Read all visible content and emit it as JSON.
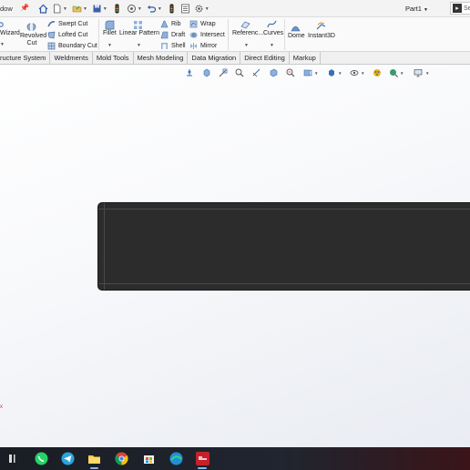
{
  "titlebar": {
    "app_menu_label": "dow",
    "document_title": "Part1",
    "search_placeholder": "Se"
  },
  "ribbon": {
    "wizard_label": "Wizard",
    "revolved_cut_line1": "Revolved",
    "revolved_cut_line2": "Cut",
    "swept_cut_label": "Swept Cut",
    "lofted_cut_label": "Lofted Cut",
    "boundary_cut_label": "Boundary Cut",
    "fillet_label": "Fillet",
    "linear_pattern_label": "Linear Pattern",
    "rib_label": "Rib",
    "draft_label": "Draft",
    "shell_label": "Shell",
    "wrap_label": "Wrap",
    "intersect_label": "Intersect",
    "mirror_label": "Mirror",
    "reference_label": "Referenc...",
    "curves_label": "Curves",
    "dome_label": "Dome",
    "instant3d_label": "Instant3D"
  },
  "tabs": [
    {
      "label": "ructure System"
    },
    {
      "label": "Weldments"
    },
    {
      "label": "Mold Tools"
    },
    {
      "label": "Mesh Modeling"
    },
    {
      "label": "Data Migration"
    },
    {
      "label": "Direct Editing"
    },
    {
      "label": "Markup"
    }
  ],
  "viewport": {
    "origin_label": "x"
  },
  "colors": {
    "part_body": "#2c2c2c",
    "ribbon_bg": "#fafafa",
    "tab_bg": "#f0f0f0",
    "taskbar_bg": "#1d2029"
  },
  "taskbar_icons": [
    "task-view-icon",
    "whatsapp-icon",
    "telegram-icon",
    "file-explorer-icon",
    "chrome-icon",
    "microsoft-store-icon",
    "edge-icon",
    "solidworks-icon"
  ]
}
